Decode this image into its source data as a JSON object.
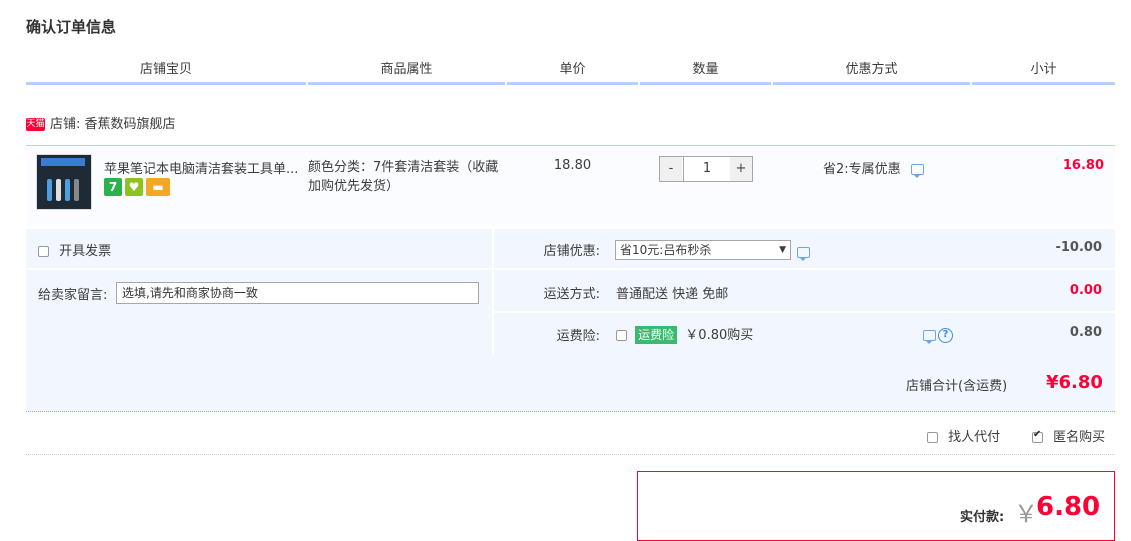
{
  "page": {
    "title": "确认订单信息"
  },
  "header": {
    "columns": [
      "店铺宝贝",
      "商品属性",
      "单价",
      "数量",
      "优惠方式",
      "小计"
    ]
  },
  "store": {
    "badge": "天猫",
    "label": "店铺: 香蕉数码旗舰店"
  },
  "item": {
    "name": "苹果笔记本电脑清洁套装工具单...",
    "attr_line1": "颜色分类：7件套清洁套装（收藏",
    "attr_line2": "加购优先发货）",
    "price": "18.80",
    "qty_minus": "-",
    "qty": "1",
    "qty_plus": "+",
    "discount": "省2:专属优惠",
    "subtotal": "16.80",
    "badges": [
      "7",
      "♥",
      "▬"
    ]
  },
  "options": {
    "invoice_label": "开具发票",
    "store_discount_label": "店铺优惠:",
    "store_discount_value": "省10元:吕布秒杀",
    "store_discount_amount": "-10.00",
    "message_label": "给卖家留言:",
    "message_placeholder": "选填,请先和商家协商一致",
    "shipping_label": "运送方式:",
    "shipping_value": "普通配送 快递 免邮",
    "shipping_amount": "0.00",
    "insurance_label": "运费险:",
    "insurance_tag": "运费险",
    "insurance_text": "￥0.80购买",
    "insurance_amount": "0.80"
  },
  "total": {
    "label": "店铺合计(含运费)",
    "amount": "¥6.80"
  },
  "extra": {
    "proxy_label": "找人代付",
    "anon_label": "匿名购买"
  },
  "pay": {
    "label": "实付款:",
    "currency": "￥",
    "amount": "6.80"
  },
  "colors": {
    "accent_red": "#ff0036",
    "header_line": "#b2d1ff",
    "row_bg": "#f2f7ff",
    "insurance_green": "#3bb96e"
  }
}
